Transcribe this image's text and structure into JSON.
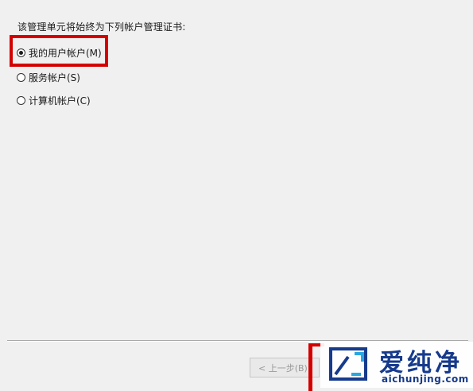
{
  "prompt": "该管理单元将始终为下列帐户管理证书:",
  "options": [
    {
      "label": "我的用户帐户(M)",
      "selected": true
    },
    {
      "label": "服务帐户(S)",
      "selected": false
    },
    {
      "label": "计算机帐户(C)",
      "selected": false
    }
  ],
  "buttons": {
    "back_label": "< 上一步(B)"
  },
  "watermark": {
    "title": "爱纯净",
    "domain": "aichunjing.com",
    "logo_icon": "window-logo-icon"
  },
  "colors": {
    "highlight": "#d40000",
    "brand": "#163a8c"
  }
}
